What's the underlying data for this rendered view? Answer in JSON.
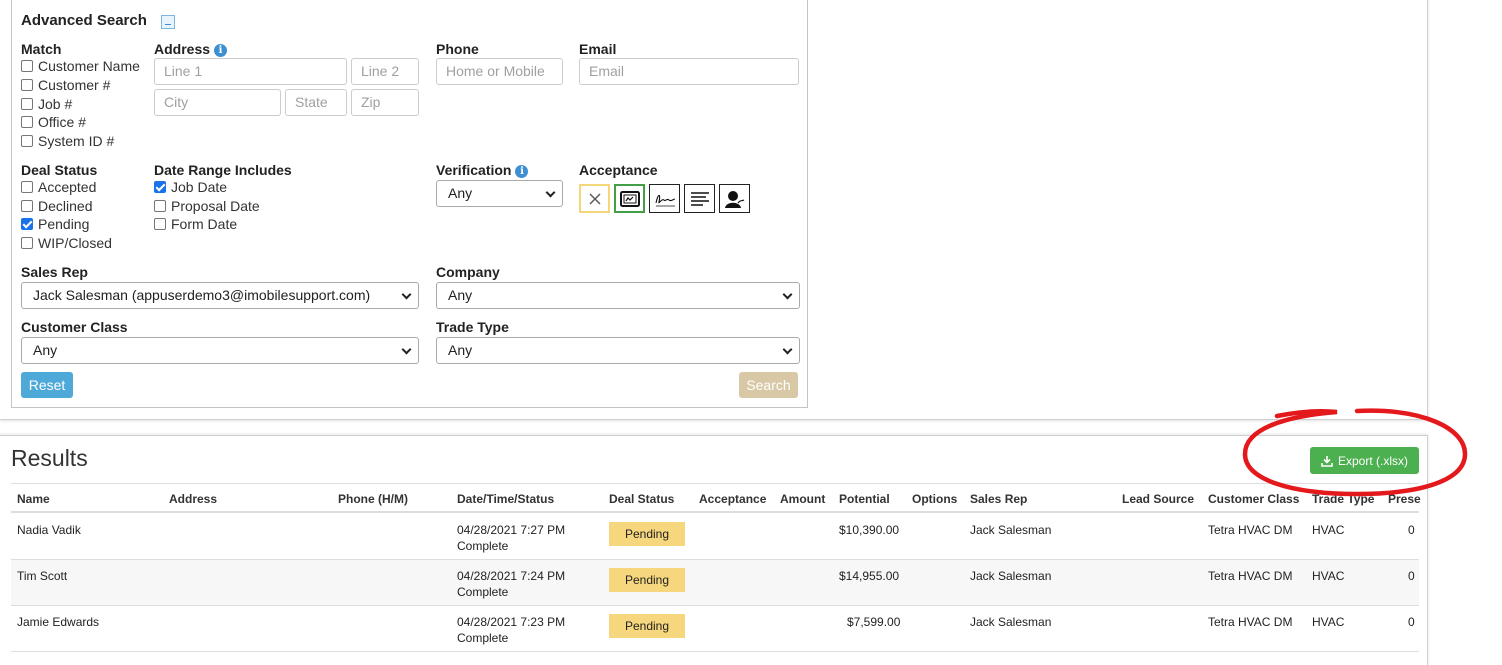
{
  "advanced_search": {
    "title": "Advanced Search",
    "match": {
      "label": "Match",
      "options": [
        {
          "label": "Customer Name",
          "checked": false
        },
        {
          "label": "Customer #",
          "checked": false
        },
        {
          "label": "Job #",
          "checked": false
        },
        {
          "label": "Office #",
          "checked": false
        },
        {
          "label": "System ID #",
          "checked": false
        }
      ]
    },
    "address": {
      "label": "Address",
      "line1_placeholder": "Line 1",
      "line2_placeholder": "Line 2",
      "city_placeholder": "City",
      "state_placeholder": "State",
      "zip_placeholder": "Zip"
    },
    "phone": {
      "label": "Phone",
      "placeholder": "Home or Mobile"
    },
    "email": {
      "label": "Email",
      "placeholder": "Email"
    },
    "deal_status": {
      "label": "Deal Status",
      "options": [
        {
          "label": "Accepted",
          "checked": false
        },
        {
          "label": "Declined",
          "checked": false
        },
        {
          "label": "Pending",
          "checked": true
        },
        {
          "label": "WIP/Closed",
          "checked": false
        }
      ]
    },
    "date_range": {
      "label": "Date Range Includes",
      "options": [
        {
          "label": "Job Date",
          "checked": true
        },
        {
          "label": "Proposal Date",
          "checked": false
        },
        {
          "label": "Form Date",
          "checked": false
        }
      ]
    },
    "verification": {
      "label": "Verification",
      "value": "Any"
    },
    "acceptance": {
      "label": "Acceptance",
      "icons": [
        "none-icon",
        "screen-sign-icon",
        "signature-icon",
        "document-icon",
        "person-sign-icon"
      ]
    },
    "sales_rep": {
      "label": "Sales Rep",
      "value": "Jack Salesman (appuserdemo3@imobilesupport.com)"
    },
    "company": {
      "label": "Company",
      "value": "Any"
    },
    "customer_class": {
      "label": "Customer Class",
      "value": "Any"
    },
    "trade_type": {
      "label": "Trade Type",
      "value": "Any"
    },
    "reset_label": "Reset",
    "search_label": "Search"
  },
  "results": {
    "title": "Results",
    "export_label": "Export (.xlsx)",
    "columns": [
      "Name",
      "Address",
      "Phone (H/M)",
      "Date/Time/Status",
      "Deal Status",
      "Acceptance",
      "Amount",
      "Potential",
      "Options",
      "Sales Rep",
      "Lead Source",
      "Customer Class",
      "Trade Type",
      "Prese"
    ],
    "rows": [
      {
        "name": "Nadia Vadik",
        "datetime": "04/28/2021 7:27 PM",
        "status": "Complete",
        "deal_status": "Pending",
        "potential": "$10,390.00",
        "sales_rep": "Jack Salesman",
        "customer_class": "Tetra HVAC DM",
        "trade_type": "HVAC",
        "prese": "0"
      },
      {
        "name": "Tim Scott",
        "datetime": "04/28/2021 7:24 PM",
        "status": "Complete",
        "deal_status": "Pending",
        "potential": "$14,955.00",
        "sales_rep": "Jack Salesman",
        "customer_class": "Tetra HVAC DM",
        "trade_type": "HVAC",
        "prese": "0"
      },
      {
        "name": "Jamie Edwards",
        "datetime": "04/28/2021 7:23 PM",
        "status": "Complete",
        "deal_status": "Pending",
        "potential": "$7,599.00",
        "sales_rep": "Jack Salesman",
        "customer_class": "Tetra HVAC DM",
        "trade_type": "HVAC",
        "prese": "0"
      }
    ]
  },
  "colors": {
    "reset": "#4ea9d9",
    "search": "#d9c8a6",
    "export": "#4caf50",
    "pending_badge": "#f7d77d",
    "annotation": "#e3191c"
  }
}
